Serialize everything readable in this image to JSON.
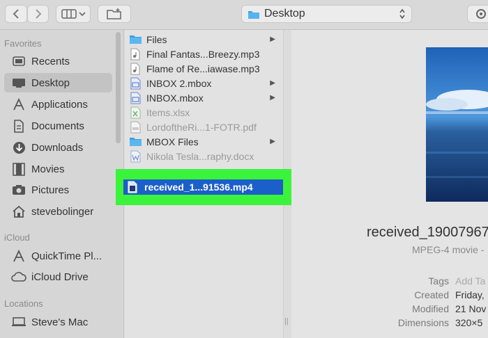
{
  "toolbar": {
    "location_title": "Desktop"
  },
  "sidebar": {
    "favorites_title": "Favorites",
    "favorites": [
      {
        "label": "Recents",
        "icon": "clock-icon"
      },
      {
        "label": "Desktop",
        "icon": "desktop-icon",
        "selected": true
      },
      {
        "label": "Applications",
        "icon": "applications-icon"
      },
      {
        "label": "Documents",
        "icon": "document-icon"
      },
      {
        "label": "Downloads",
        "icon": "download-icon"
      },
      {
        "label": "Movies",
        "icon": "film-icon"
      },
      {
        "label": "Pictures",
        "icon": "camera-icon"
      },
      {
        "label": "stevebolinger",
        "icon": "home-icon"
      }
    ],
    "icloud_title": "iCloud",
    "icloud": [
      {
        "label": "QuickTime Pl...",
        "icon": "applications-icon"
      },
      {
        "label": "iCloud Drive",
        "icon": "cloud-icon"
      }
    ],
    "locations_title": "Locations",
    "locations": [
      {
        "label": "Steve's Mac",
        "icon": "computer-icon"
      }
    ]
  },
  "files": [
    {
      "name": "Files",
      "type": "folder",
      "arrow": true
    },
    {
      "name": "Final Fantas...Breezy.mp3",
      "type": "audio"
    },
    {
      "name": "Flame of Re...iawase.mp3",
      "type": "audio"
    },
    {
      "name": "INBOX 2.mbox",
      "type": "mbox",
      "arrow": true
    },
    {
      "name": "INBOX.mbox",
      "type": "mbox",
      "arrow": true
    },
    {
      "name": "Items.xlsx",
      "type": "excel",
      "dim": true
    },
    {
      "name": "LordoftheRi...1-FOTR.pdf",
      "type": "pdf",
      "dim": true
    },
    {
      "name": "MBOX Files",
      "type": "folder",
      "arrow": true
    },
    {
      "name": "Nikola Tesla...raphy.docx",
      "type": "word",
      "dim": true
    }
  ],
  "selected_file": {
    "name": "received_1...91536.mp4",
    "highlight_color": "#3cf33c",
    "selection_color": "#1b5fc9"
  },
  "preview": {
    "file_name": "received_190079677",
    "kind": "MPEG-4 movie -",
    "info": [
      {
        "label": "Tags",
        "value": "Add Ta",
        "muted": true
      },
      {
        "label": "Created",
        "value": "Friday,"
      },
      {
        "label": "Modified",
        "value": "21 Nov"
      },
      {
        "label": "Dimensions",
        "value": "320×5"
      }
    ]
  }
}
